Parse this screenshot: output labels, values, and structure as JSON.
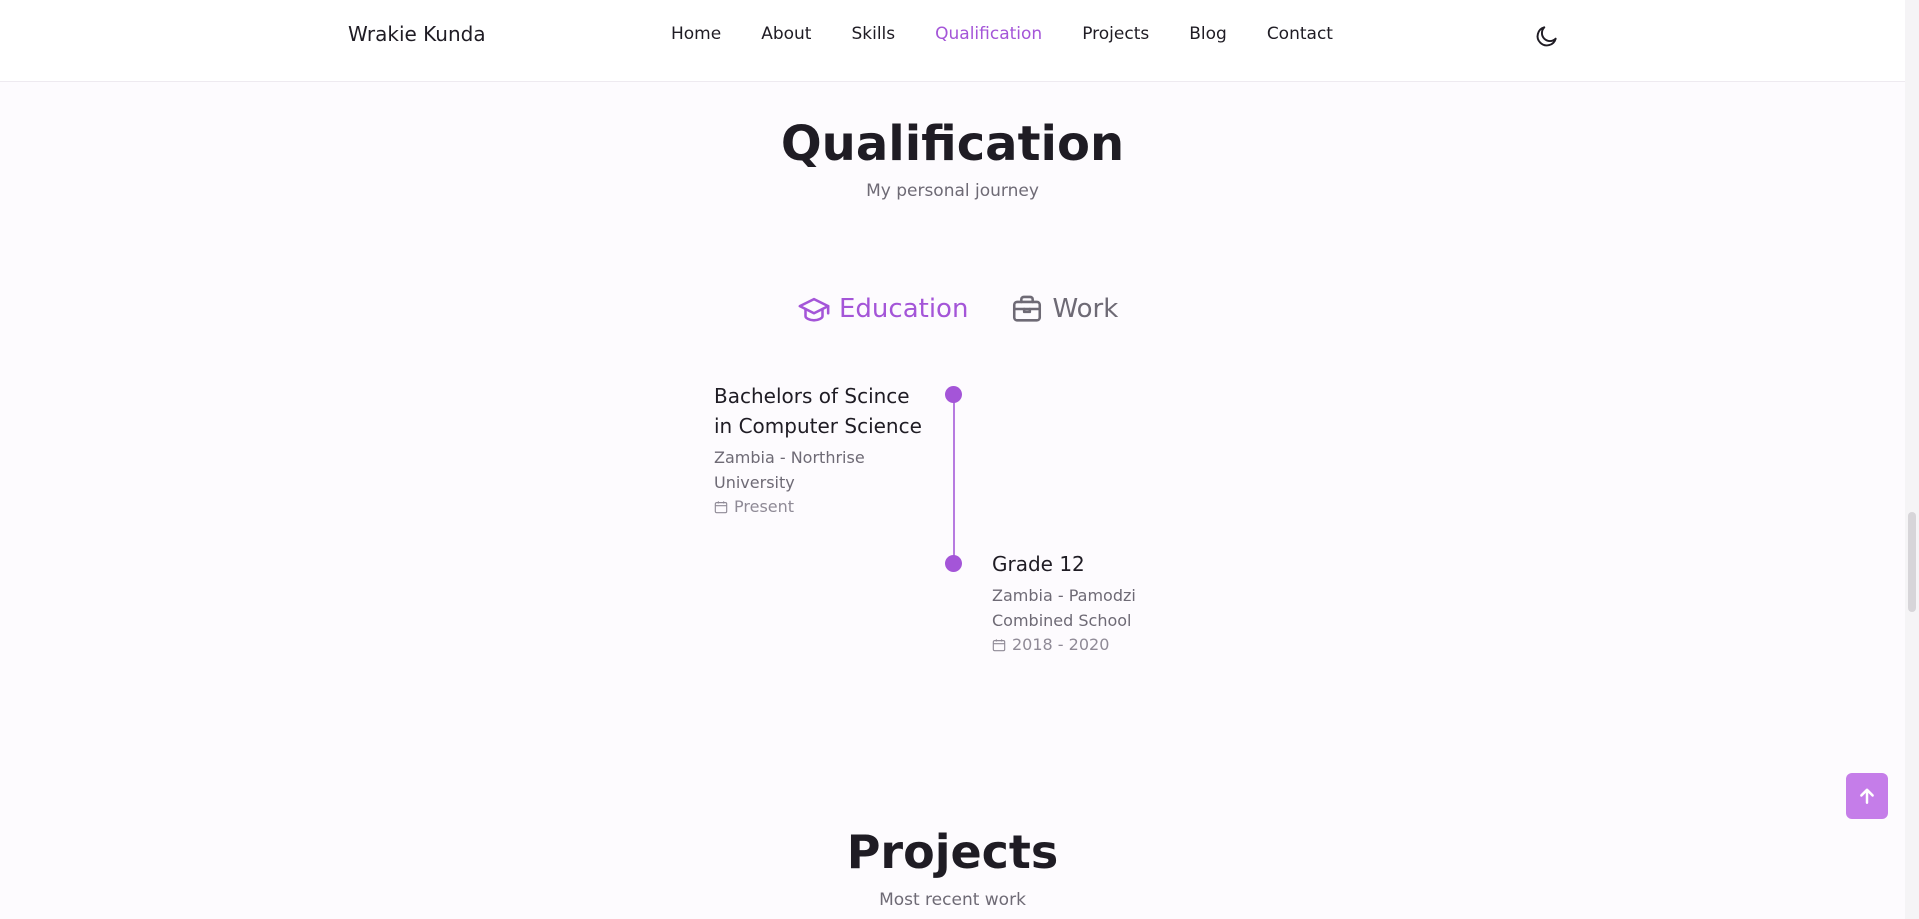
{
  "header": {
    "logo": "Wrakie Kunda",
    "nav": [
      "Home",
      "About",
      "Skills",
      "Qualification",
      "Projects",
      "Blog",
      "Contact"
    ],
    "active_nav": "Qualification",
    "theme_icon": "moon-icon"
  },
  "qualification": {
    "title": "Qualification",
    "subtitle": "My personal journey",
    "tabs": [
      {
        "label": "Education",
        "icon": "graduation-cap-icon",
        "active": true
      },
      {
        "label": "Work",
        "icon": "briefcase-icon",
        "active": false
      }
    ],
    "items": [
      {
        "title": "Bachelors of Scince in Computer Science",
        "subtitle": "Zambia - Northrise University",
        "date": "Present",
        "side": "left"
      },
      {
        "title": "Grade 12",
        "subtitle": "Zambia - Pamodzi Combined School",
        "date": "2018 - 2020",
        "side": "right"
      }
    ]
  },
  "projects": {
    "title": "Projects",
    "subtitle": "Most recent work"
  },
  "scroll_up": {
    "icon": "arrow-up-icon"
  },
  "colors": {
    "accent": "#a455d8",
    "scroll_button": "#c57de9",
    "text": "#1f1c24",
    "muted": "#6e6a75"
  }
}
